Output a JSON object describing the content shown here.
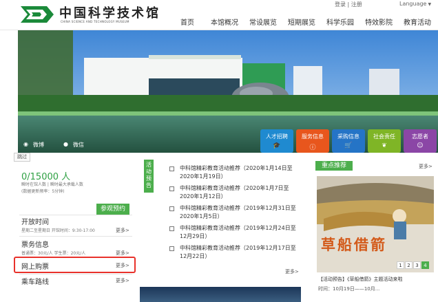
{
  "header": {
    "logo_cn": "中国科学技术馆",
    "logo_en": "CHINA SCIENCE AND TECHNOLOGY MUSEUM",
    "links": "登录 | 注册",
    "language": "Language",
    "nav": [
      "首页",
      "本馆概况",
      "常设展览",
      "短期展览",
      "科学乐园",
      "特效影院",
      "教育活动"
    ]
  },
  "banner": {
    "social": [
      {
        "label": "微博",
        "icon": "weibo-icon"
      },
      {
        "label": "微信",
        "icon": "wechat-icon"
      }
    ],
    "tiles": [
      {
        "label": "人才招聘",
        "color": "#1f8ad0",
        "icon": "graduation-cap-icon"
      },
      {
        "label": "服务信息",
        "color": "#e8561d",
        "icon": "info-icon"
      },
      {
        "label": "采购信息",
        "color": "#2574c6",
        "icon": "cart-icon"
      },
      {
        "label": "社会责任",
        "color": "#7fb526",
        "icon": "leaf-icon"
      },
      {
        "label": "志愿者",
        "color": "#8b46a6",
        "icon": "people-icon"
      }
    ]
  },
  "left": {
    "skip_label": "跳过",
    "count": "0/15000 人",
    "count_note": "瞬时在馆人数 | 瞬时最大承载人数",
    "count_sub": "(数据更新频率：5分钟)",
    "visit_tab": "参观预约",
    "open_title": "开放时间",
    "open_text": "星期二至星期日 开馆时间：9:30-17:00",
    "ticket_title": "票务信息",
    "ticket_text": "普通票：30元/人   学生票：20元/人",
    "online_title": "网上购票",
    "route_title": "乘车路线",
    "more": "更多>"
  },
  "activities": {
    "tab": "活动预告",
    "items": [
      "中科馆精彩教育活动推荐（2020年1月14日至2020年1月19日）",
      "中科馆精彩教育活动推荐（2020年1月7日至2020年1月12日）",
      "中科馆精彩教育活动推荐（2019年12月31日至2020年1月5日）",
      "中科馆精彩教育活动推荐（2019年12月24日至12月29日）",
      "中科馆精彩教育活动推荐（2019年12月17日至12月22日）"
    ],
    "more": "更多>"
  },
  "featured": {
    "tab": "重点推荐",
    "more": "更多>",
    "image_title": "草船借箭",
    "pages": [
      "1",
      "2",
      "3",
      "4"
    ],
    "active_page": 3,
    "caption": "【活动预告】《草船借箭》主题活动来啦",
    "time": "时间：10月19日——10月..."
  },
  "colors": {
    "accent": "#4cae4c",
    "highlight": "#e8312a"
  }
}
